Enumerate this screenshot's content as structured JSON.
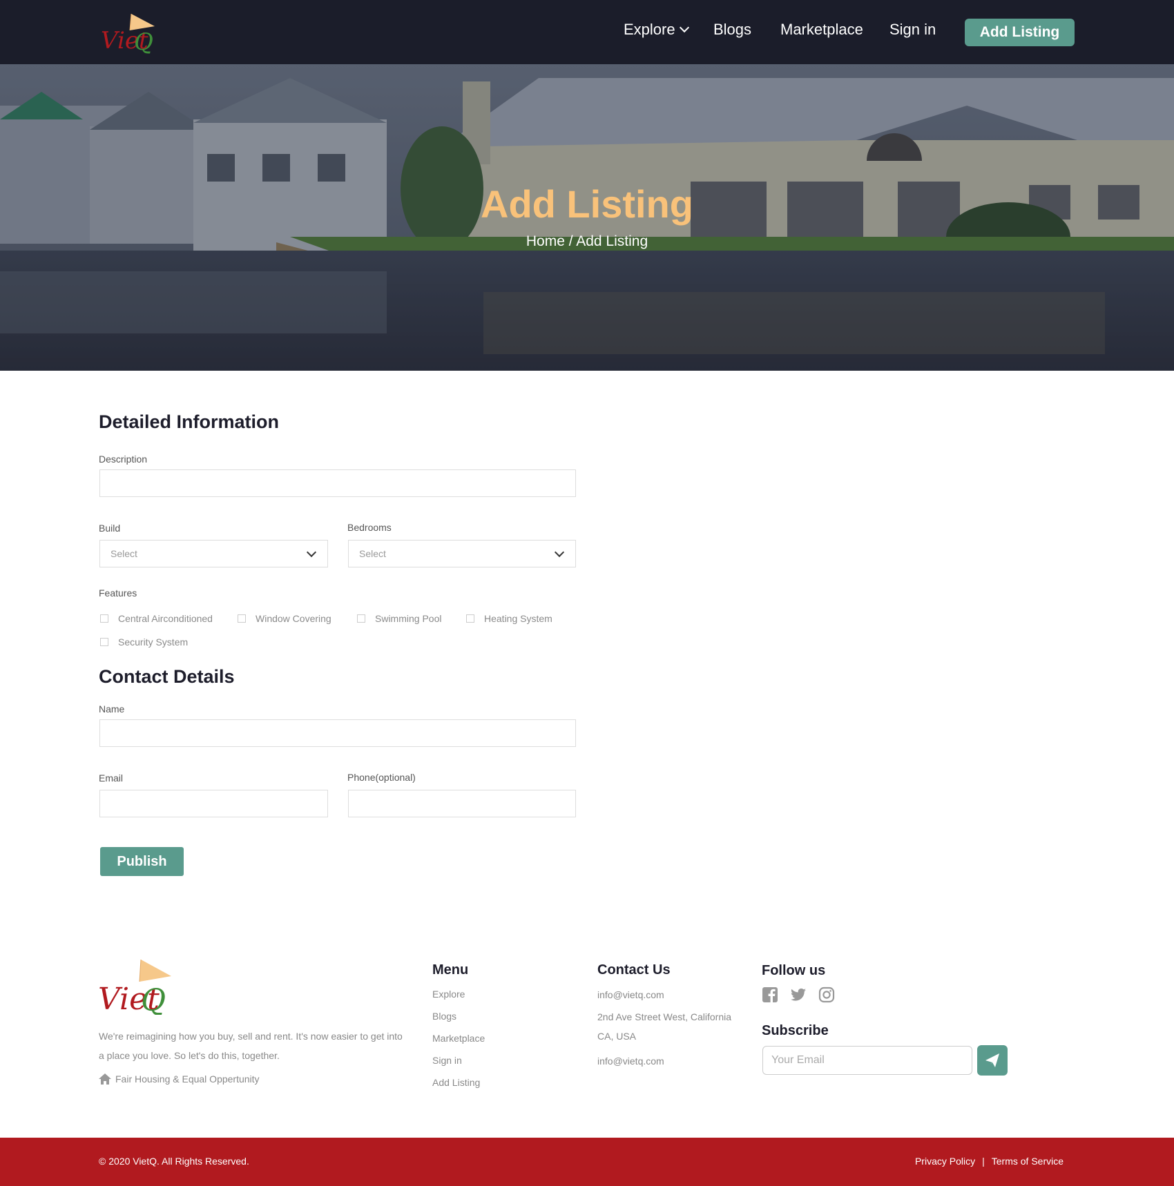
{
  "brand": {
    "logo_text": "VietQ"
  },
  "nav": {
    "explore": "Explore",
    "blogs": "Blogs",
    "marketplace": "Marketplace",
    "signin": "Sign in",
    "cta": "Add Listing"
  },
  "hero": {
    "title": "Add Listing",
    "breadcrumb": "Home / Add Listing"
  },
  "detailed": {
    "title": "Detailed Information",
    "description_label": "Description",
    "build_label": "Build",
    "build_placeholder": "Select",
    "bedrooms_label": "Bedrooms",
    "bedrooms_placeholder": "Select",
    "features_label": "Features",
    "features": [
      "Central Airconditioned",
      "Window Covering",
      "Swimming Pool",
      "Heating System",
      "Security System"
    ]
  },
  "contact": {
    "title": "Contact Details",
    "name_label": "Name",
    "email_label": "Email",
    "phone_label": "Phone(optional)",
    "publish": "Publish"
  },
  "footer": {
    "about": "We're reimagining how you buy, sell and rent. It's now easier to get into a place you love. So let's do this, together.",
    "fair_housing": "Fair Housing & Equal Oppertunity",
    "menu_title": "Menu",
    "menu": [
      "Explore",
      "Blogs",
      "Marketplace",
      "Sign in",
      "Add Listing"
    ],
    "contact_title": "Contact Us",
    "contact_email1": "info@vietq.com",
    "contact_address1": "2nd Ave Street West, California",
    "contact_address2": "CA, USA",
    "contact_email2": "info@vietq.com",
    "follow_title": "Follow us",
    "socials": [
      "facebook-icon",
      "twitter-icon",
      "instagram-icon"
    ],
    "subscribe_title": "Subscribe",
    "subscribe_placeholder": "Your Email",
    "copyright": "© 2020 VietQ. All Rights Reserved.",
    "privacy": "Privacy Policy",
    "separator": "|",
    "terms": "Terms of Service"
  },
  "colors": {
    "nav_bg": "#1b1d2a",
    "accent": "#5a9b8d",
    "hero_title": "#f9c27a",
    "footer_bar": "#b11a1f",
    "brand_red": "#b11a1f",
    "brand_green": "#3f8f3a"
  }
}
